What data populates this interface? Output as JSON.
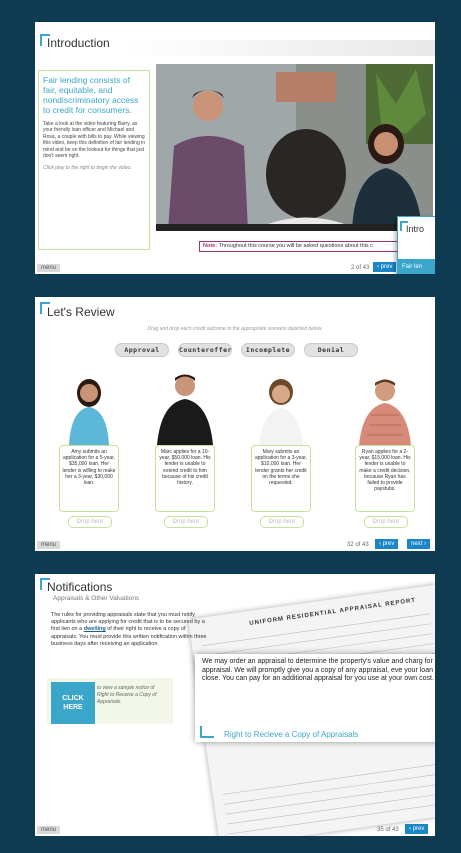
{
  "colors": {
    "background": "#0e3a52",
    "accent": "#3aa6c9",
    "highlight": "#c4e29b",
    "nav": "#1a86c8",
    "note_border": "#a4336b"
  },
  "slide1": {
    "title": "Introduction",
    "heading": "Fair lending consists of fair, equitable, and nondiscriminatory access to credit for consumers.",
    "body": "Take a look at the video featuring Barry, as your friendly loan officer and Michael and Rosa, a couple with bills to pay. While viewing this video, keep this definition of fair lending in mind and be on the lookout for things that just don't seem right.",
    "hint": "Click play to the right to begin the video.",
    "note_label": "Note:",
    "note_text": "Throughout this course you will be asked questions about this c",
    "menu": "menu",
    "page": "2 of 43",
    "prev": "prev",
    "peek_title": "Intro",
    "peek_sub": "Fair len"
  },
  "slide2": {
    "title": "Let's Review",
    "instructions": "Drag and drop each credit outcome to the appropriate scenario depicted below.",
    "categories": [
      "Approval",
      "Counteroffer",
      "Incomplete",
      "Denial"
    ],
    "scenarios": [
      {
        "text": "Amy submits an application for a 5-year, $35,000 loan. Her lender is willing to make her a 3-year, $30,000 loan.",
        "drop": "Drop here"
      },
      {
        "text": "Marc applies for a 10-year, $50,000 loan. His lender is unable to extend credit to him because of his credit history.",
        "drop": "Drop here"
      },
      {
        "text": "Mary submits an application for a 3-year, $10,000 loan. Her lender grants her credit on the terms she requested.",
        "drop": "Drop here"
      },
      {
        "text": "Ryan applies for a 2-year, $15,000 loan. His lender is unable to make a credit decision, because Ryan has failed to provide paystubs.",
        "drop": "Drop here"
      }
    ],
    "menu": "menu",
    "page": "32 of 43",
    "prev": "prev",
    "next": "next"
  },
  "slide3": {
    "title": "Notifications",
    "subtitle": "Appraisals & Other Valuations",
    "body_pre": "The rules for providing appraisals state that you must notify applicants who are applying for credit that is to be secured by a first lien on a",
    "body_link": "dwelling",
    "body_post": "of their right to receive a copy of appraisals. You must provide this written notification within three business days after receiving an application.",
    "click_here": "CLICK HERE",
    "click_desc": "to view a sample notice of Right to Receive a Copy of Appraisals.",
    "report_title": "UNIFORM RESIDENTIAL APPRAISAL REPORT",
    "popup_text": "We may order an appraisal to determine the property's value and charg for this appraisal. We will promptly give you a copy of any appraisal, eve your loan does not close. You can pay for an additional appraisal for you use at your own cost.",
    "popup_link": "Right to Recieve a Copy of Appraisals",
    "menu": "menu",
    "page": "35 of 43",
    "prev": "prev"
  }
}
